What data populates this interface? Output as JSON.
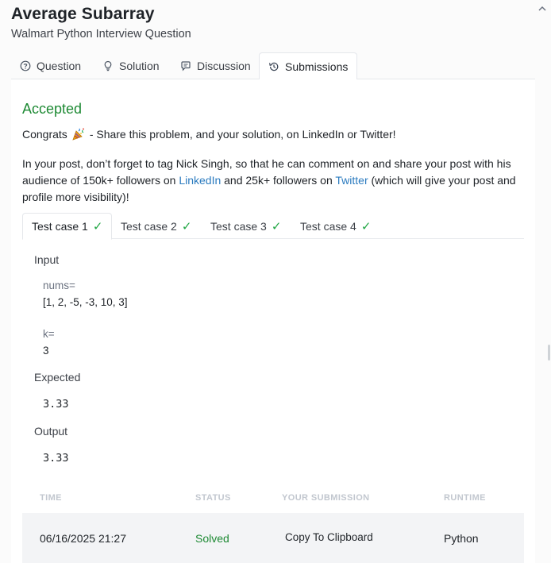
{
  "header": {
    "title": "Average Subarray",
    "subtitle": "Walmart Python Interview Question"
  },
  "main_tabs": [
    {
      "label": "Question",
      "icon": "question-circle-icon"
    },
    {
      "label": "Solution",
      "icon": "lightbulb-icon"
    },
    {
      "label": "Discussion",
      "icon": "chat-bubble-icon"
    },
    {
      "label": "Submissions",
      "icon": "history-icon",
      "active": true
    }
  ],
  "result": {
    "status": "Accepted",
    "congrats_prefix": "Congrats",
    "congrats_suffix": "- Share this problem, and your solution, on LinkedIn or Twitter!",
    "para_1": "In your post, don’t forget to tag Nick Singh, so that he can comment on and share your post with his audience of 150k+ followers on ",
    "linkedin_link": "LinkedIn",
    "para_2": " and 25k+ followers on ",
    "twitter_link": "Twitter",
    "para_3": " (which will give your post and profile more visibility)!"
  },
  "test_cases": [
    {
      "label": "Test case 1",
      "passed": "✓",
      "active": true
    },
    {
      "label": "Test case 2",
      "passed": "✓"
    },
    {
      "label": "Test case 3",
      "passed": "✓"
    },
    {
      "label": "Test case 4",
      "passed": "✓"
    }
  ],
  "test_detail": {
    "input_label": "Input",
    "var1_name": "nums=",
    "var1_value": "[1, 2, -5, -3, 10, 3]",
    "var2_name": "k=",
    "var2_value": "3",
    "expected_label": "Expected",
    "expected_value": "3.33",
    "output_label": "Output",
    "output_value": "3.33"
  },
  "submissions": {
    "columns": [
      "TIME",
      "STATUS",
      "YOUR SUBMISSION",
      "RUNTIME"
    ],
    "rows": [
      {
        "time": "06/16/2025 21:27",
        "status": "Solved",
        "submission": "Copy To Clipboard",
        "runtime": "Python"
      }
    ]
  },
  "colors": {
    "accepted": "#1e8a34",
    "link": "#2b7bbf",
    "check": "#22a745"
  }
}
